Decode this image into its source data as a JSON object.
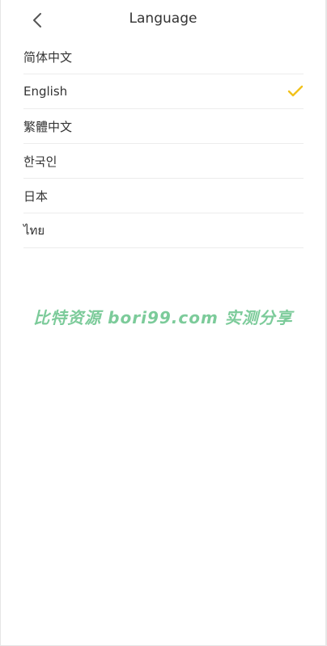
{
  "header": {
    "back_icon": "chevron-left-icon",
    "title": "Language"
  },
  "languages": [
    {
      "label": "简体中文",
      "selected": false
    },
    {
      "label": "English",
      "selected": true
    },
    {
      "label": "繁體中文",
      "selected": false
    },
    {
      "label": "한국인",
      "selected": false
    },
    {
      "label": "日本",
      "selected": false
    },
    {
      "label": "ไทย",
      "selected": false
    }
  ],
  "watermark": {
    "text": "比特资源 bori99.com 实测分享"
  },
  "colors": {
    "check": "#f2c21b",
    "watermark": "#7ccb9a",
    "divider": "#ececec",
    "text": "#333333"
  }
}
